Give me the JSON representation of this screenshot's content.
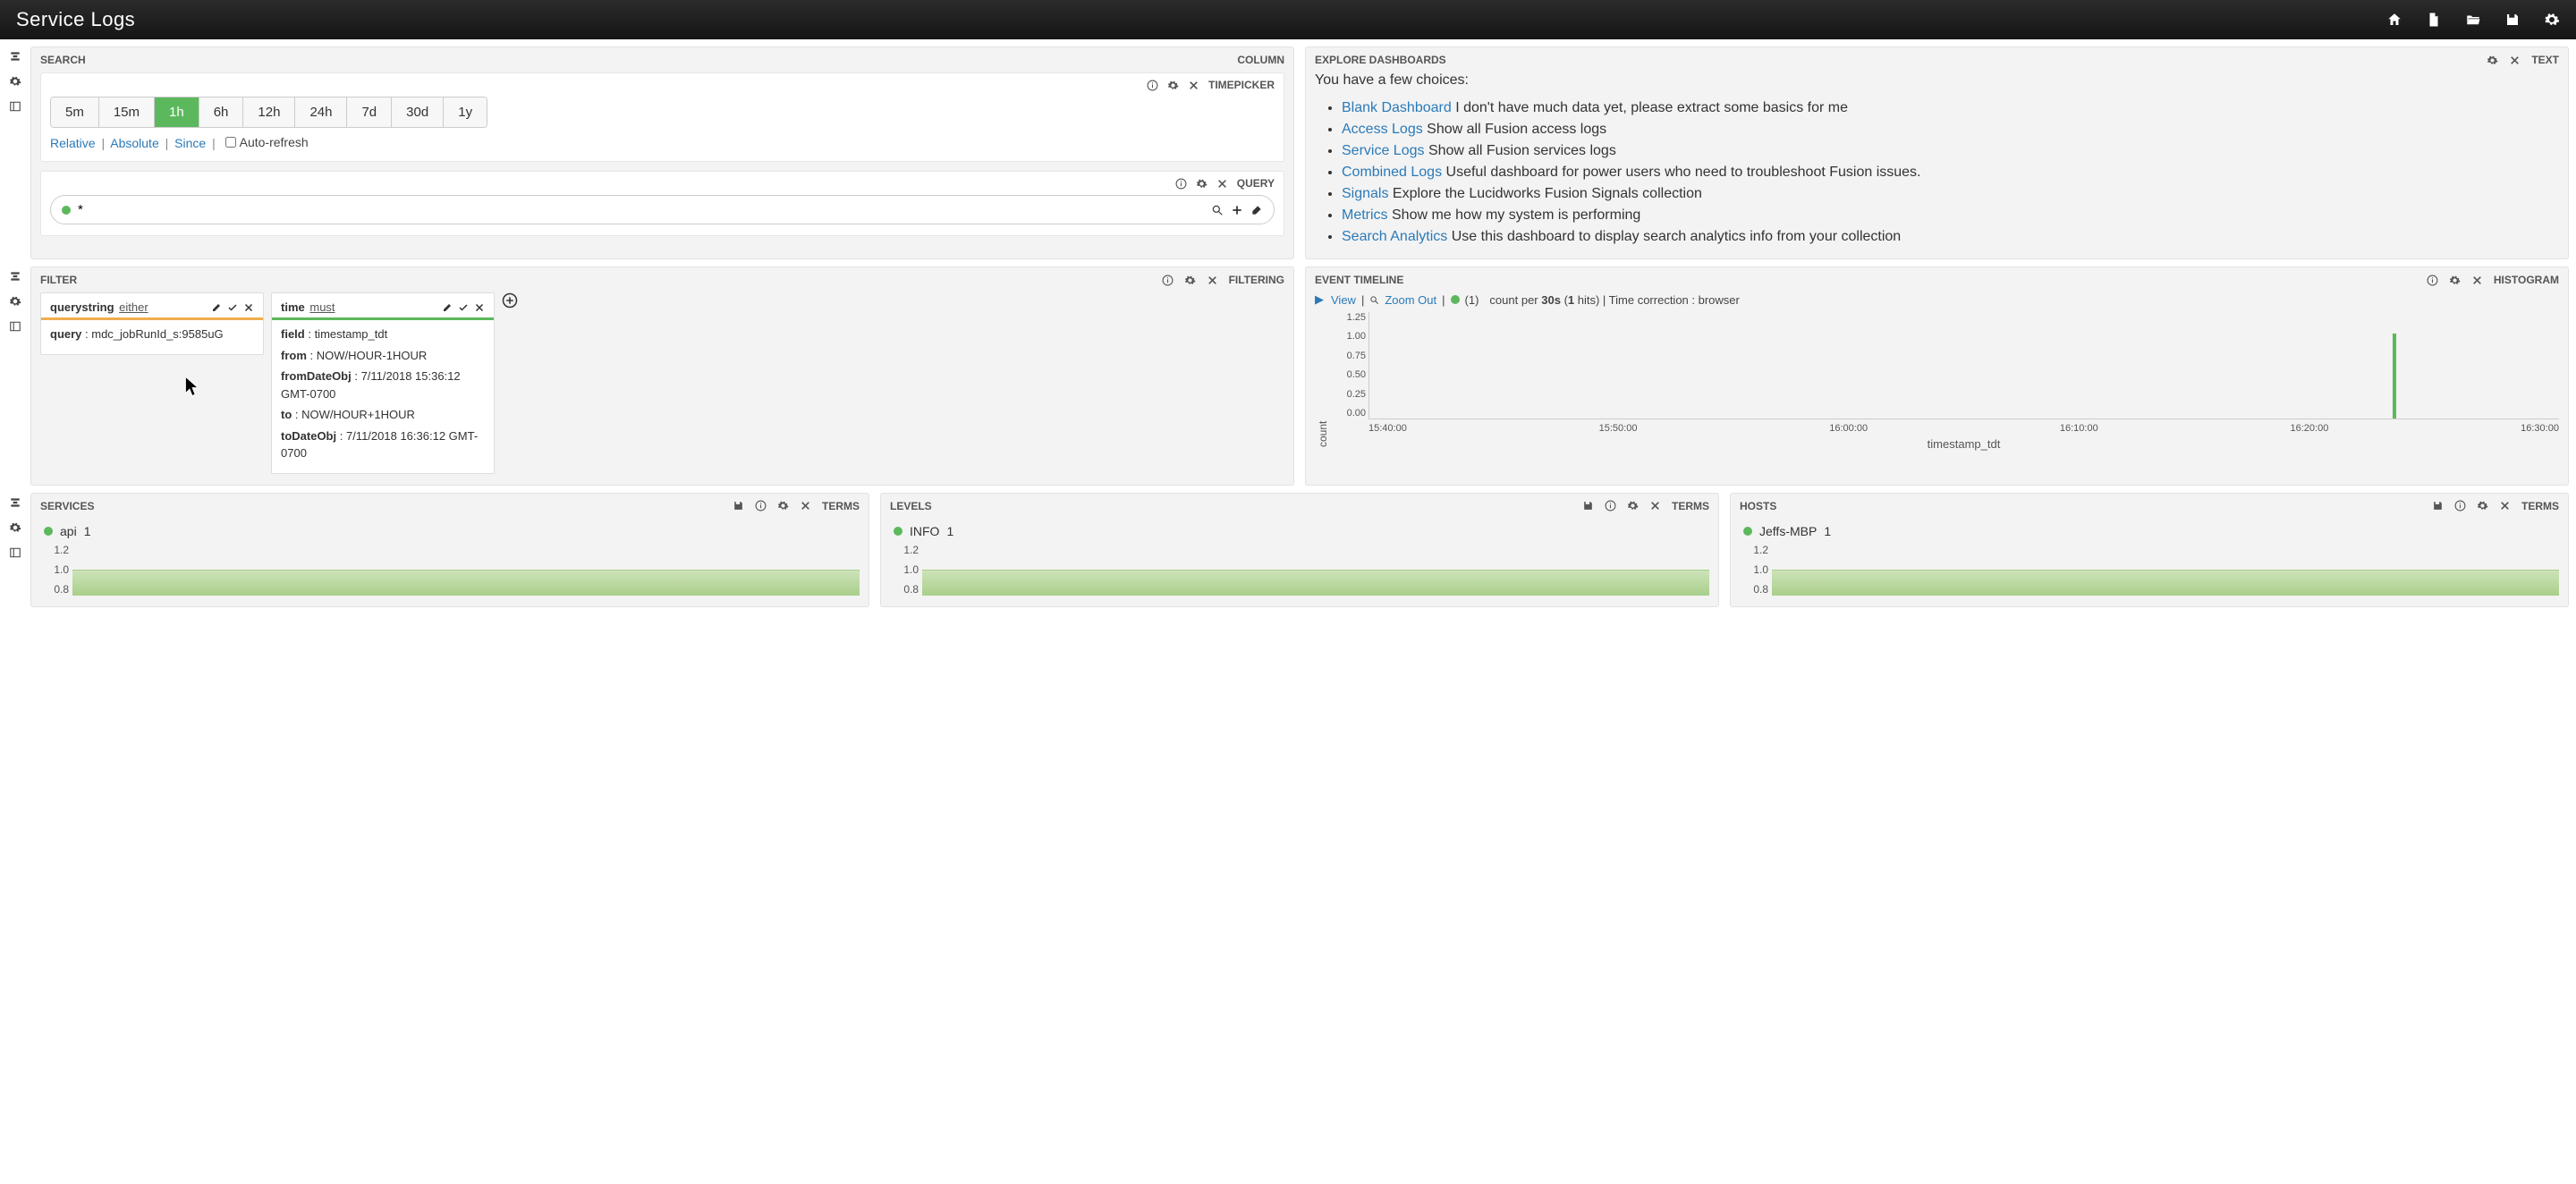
{
  "app": {
    "title": "Service Logs"
  },
  "topnav_icons": [
    "home",
    "file",
    "folder-open",
    "save",
    "gear"
  ],
  "leftrail_icons": [
    "collapse",
    "gear",
    "sidebar"
  ],
  "panels": {
    "search": {
      "title": "SEARCH",
      "type_label": "COLUMN",
      "timepicker": {
        "label": "TIMEPICKER",
        "options": [
          "5m",
          "15m",
          "1h",
          "6h",
          "12h",
          "24h",
          "7d",
          "30d",
          "1y"
        ],
        "active": "1h",
        "links": {
          "relative": "Relative",
          "absolute": "Absolute",
          "since": "Since"
        },
        "autorefresh_label": "Auto-refresh",
        "autorefresh_checked": false
      },
      "query": {
        "label": "QUERY",
        "value": "*"
      }
    },
    "explore": {
      "title": "EXPLORE DASHBOARDS",
      "type_label": "TEXT",
      "intro": "You have a few choices:",
      "items": [
        {
          "link": "Blank Dashboard",
          "desc": "I don't have much data yet, please extract some basics for me"
        },
        {
          "link": "Access Logs",
          "desc": "Show all Fusion access logs"
        },
        {
          "link": "Service Logs",
          "desc": "Show all Fusion services logs"
        },
        {
          "link": "Combined Logs",
          "desc": "Useful dashboard for power users who need to troubleshoot Fusion issues."
        },
        {
          "link": "Signals",
          "desc": "Explore the Lucidworks Fusion Signals collection"
        },
        {
          "link": "Metrics",
          "desc": "Show me how my system is performing"
        },
        {
          "link": "Search Analytics",
          "desc": "Use this dashboard to display search analytics info from your collection"
        }
      ]
    },
    "filter": {
      "title": "FILTER",
      "type_label": "FILTERING",
      "cards": [
        {
          "type": "querystring",
          "mode": "either",
          "stripe": "orange",
          "fields": [
            {
              "k": "query",
              "v": "mdc_jobRunId_s:9585uG"
            }
          ]
        },
        {
          "type": "time",
          "mode": "must",
          "stripe": "green",
          "fields": [
            {
              "k": "field",
              "v": "timestamp_tdt"
            },
            {
              "k": "from",
              "v": "NOW/HOUR-1HOUR"
            },
            {
              "k": "fromDateObj",
              "v": "7/11/2018 15:36:12 GMT-0700"
            },
            {
              "k": "to",
              "v": "NOW/HOUR+1HOUR"
            },
            {
              "k": "toDateObj",
              "v": "7/11/2018 16:36:12 GMT-0700"
            }
          ]
        }
      ]
    },
    "timeline": {
      "title": "EVENT TIMELINE",
      "type_label": "HISTOGRAM",
      "view_label": "View",
      "zoom_label": "Zoom Out",
      "series_count": "(1)",
      "count_per_pre": "count per ",
      "count_per_val": "30s",
      "hits_pre": " (",
      "hits_val": "1",
      "hits_post": " hits) | Time correction : browser",
      "ylabel": "count",
      "xlabel": "timestamp_tdt"
    },
    "services": {
      "title": "SERVICES",
      "type_label": "TERMS",
      "legend_name": "api",
      "legend_count": "1"
    },
    "levels": {
      "title": "LEVELS",
      "type_label": "TERMS",
      "legend_name": "INFO",
      "legend_count": "1"
    },
    "hosts": {
      "title": "HOSTS",
      "type_label": "TERMS",
      "legend_name": "Jeffs-MBP",
      "legend_count": "1"
    }
  },
  "chart_data": [
    {
      "id": "event_timeline",
      "type": "bar",
      "title": "EVENT TIMELINE",
      "xlabel": "timestamp_tdt",
      "ylabel": "count",
      "ylim": [
        0,
        1.25
      ],
      "yticks": [
        1.25,
        1.0,
        0.75,
        0.5,
        0.25,
        0.0
      ],
      "xticks": [
        "15:40:00",
        "15:50:00",
        "16:00:00",
        "16:10:00",
        "16:20:00",
        "16:30:00"
      ],
      "bin": "30s",
      "hits": 1,
      "series": [
        {
          "name": "count",
          "color": "#5cb85c",
          "points": [
            {
              "x": "16:22:30",
              "x_frac": 0.86,
              "y": 1.0
            }
          ]
        }
      ]
    },
    {
      "id": "services_terms",
      "type": "bar",
      "title": "SERVICES",
      "ylim": [
        0.8,
        1.2
      ],
      "yticks": [
        1.2,
        1.0,
        0.8
      ],
      "categories": [
        "api"
      ],
      "values": [
        1
      ]
    },
    {
      "id": "levels_terms",
      "type": "bar",
      "title": "LEVELS",
      "ylim": [
        0.8,
        1.2
      ],
      "yticks": [
        1.2,
        1.0,
        0.8
      ],
      "categories": [
        "INFO"
      ],
      "values": [
        1
      ]
    },
    {
      "id": "hosts_terms",
      "type": "bar",
      "title": "HOSTS",
      "ylim": [
        0.8,
        1.2
      ],
      "yticks": [
        1.2,
        1.0,
        0.8
      ],
      "categories": [
        "Jeffs-MBP"
      ],
      "values": [
        1
      ]
    }
  ]
}
